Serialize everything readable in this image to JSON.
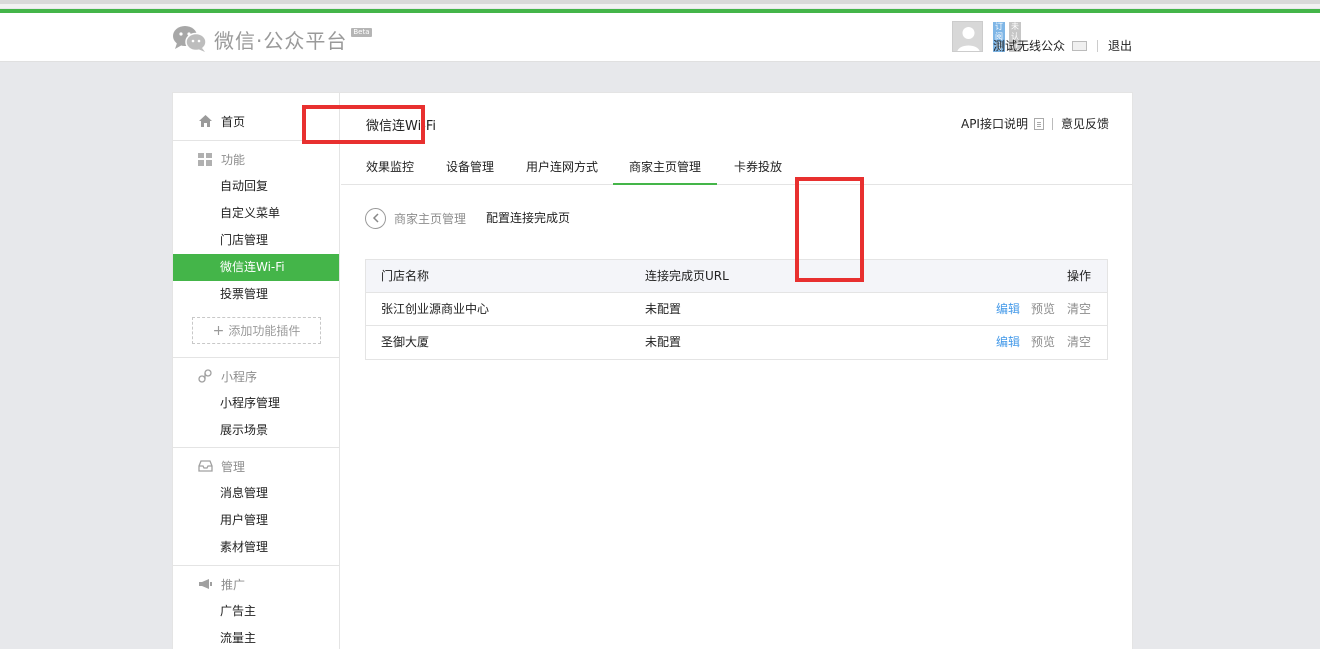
{
  "header": {
    "logo_text": "微信·公众平台",
    "beta": "Beta",
    "account_tag_type": "订阅号",
    "account_tag_status": "未认证",
    "account_name": "测试无线公众",
    "logout": "退出"
  },
  "sidebar": {
    "home": "首页",
    "sections": [
      {
        "title": "功能",
        "items": [
          "自动回复",
          "自定义菜单",
          "门店管理",
          "微信连Wi-Fi",
          "投票管理"
        ],
        "active_index": 3,
        "add_plugin": "添加功能插件"
      },
      {
        "title": "小程序",
        "items": [
          "小程序管理",
          "展示场景"
        ]
      },
      {
        "title": "管理",
        "items": [
          "消息管理",
          "用户管理",
          "素材管理"
        ]
      },
      {
        "title": "推广",
        "items": [
          "广告主",
          "流量主"
        ]
      }
    ]
  },
  "main": {
    "title": "微信连Wi-Fi",
    "api_link": "API接口说明",
    "feedback_link": "意见反馈",
    "tabs": [
      "效果监控",
      "设备管理",
      "用户连网方式",
      "商家主页管理",
      "卡券投放"
    ],
    "active_tab": 3,
    "breadcrumb_parent": "商家主页管理",
    "breadcrumb_current": "配置连接完成页",
    "table": {
      "headers": [
        "门店名称",
        "连接完成页URL",
        "操作"
      ],
      "rows": [
        {
          "store": "张江创业源商业中心",
          "url": "未配置",
          "edit": "编辑",
          "preview": "预览",
          "clear": "清空"
        },
        {
          "store": "圣御大厦",
          "url": "未配置",
          "edit": "编辑",
          "preview": "预览",
          "clear": "清空"
        }
      ]
    }
  },
  "colors": {
    "brand_green": "#44b549",
    "link_blue": "#459ae9",
    "highlight_red": "#e8302f"
  }
}
